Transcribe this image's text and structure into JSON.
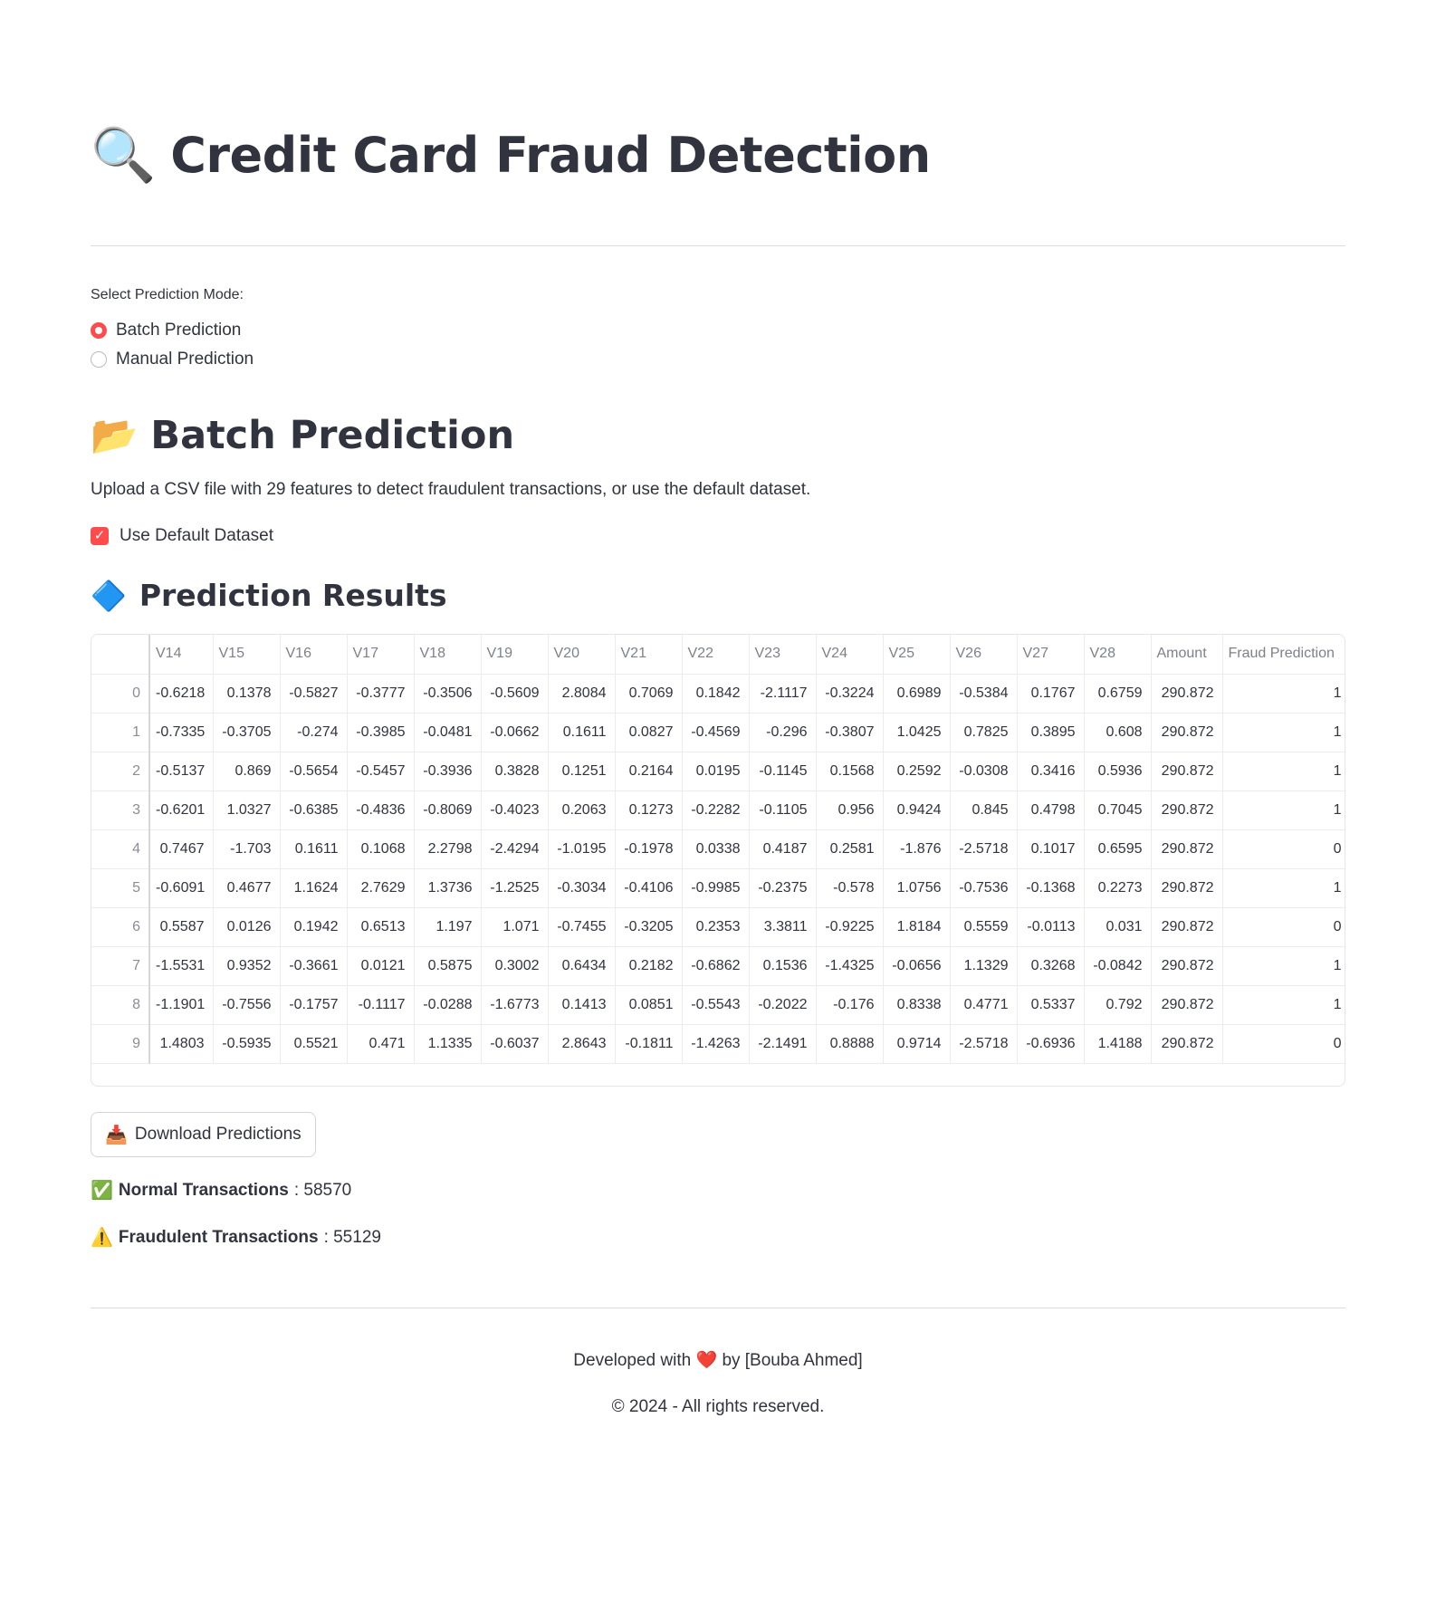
{
  "header": {
    "title_icon": "magnifier-icon",
    "title": "Credit Card Fraud Detection"
  },
  "mode": {
    "label": "Select Prediction Mode:",
    "options": [
      {
        "label": "Batch Prediction",
        "selected": true
      },
      {
        "label": "Manual Prediction",
        "selected": false
      }
    ]
  },
  "batch": {
    "icon": "folder-icon",
    "title": "Batch Prediction",
    "description": "Upload a CSV file with 29 features to detect fraudulent transactions, or use the default dataset.",
    "default_dataset_label": "Use Default Dataset",
    "default_dataset_checked": true
  },
  "results": {
    "icon": "blue-diamond-icon",
    "title": "Prediction Results",
    "columns": [
      "",
      "V14",
      "V15",
      "V16",
      "V17",
      "V18",
      "V19",
      "V20",
      "V21",
      "V22",
      "V23",
      "V24",
      "V25",
      "V26",
      "V27",
      "V28",
      "Amount",
      "Fraud Prediction"
    ],
    "rows": [
      [
        "0",
        "-0.6218",
        "0.1378",
        "-0.5827",
        "-0.3777",
        "-0.3506",
        "-0.5609",
        "2.8084",
        "0.7069",
        "0.1842",
        "-2.1117",
        "-0.3224",
        "0.6989",
        "-0.5384",
        "0.1767",
        "0.6759",
        "290.872",
        "1"
      ],
      [
        "1",
        "-0.7335",
        "-0.3705",
        "-0.274",
        "-0.3985",
        "-0.0481",
        "-0.0662",
        "0.1611",
        "0.0827",
        "-0.4569",
        "-0.296",
        "-0.3807",
        "1.0425",
        "0.7825",
        "0.3895",
        "0.608",
        "290.872",
        "1"
      ],
      [
        "2",
        "-0.5137",
        "0.869",
        "-0.5654",
        "-0.5457",
        "-0.3936",
        "0.3828",
        "0.1251",
        "0.2164",
        "0.0195",
        "-0.1145",
        "0.1568",
        "0.2592",
        "-0.0308",
        "0.3416",
        "0.5936",
        "290.872",
        "1"
      ],
      [
        "3",
        "-0.6201",
        "1.0327",
        "-0.6385",
        "-0.4836",
        "-0.8069",
        "-0.4023",
        "0.2063",
        "0.1273",
        "-0.2282",
        "-0.1105",
        "0.956",
        "0.9424",
        "0.845",
        "0.4798",
        "0.7045",
        "290.872",
        "1"
      ],
      [
        "4",
        "0.7467",
        "-1.703",
        "0.1611",
        "0.1068",
        "2.2798",
        "-2.4294",
        "-1.0195",
        "-0.1978",
        "0.0338",
        "0.4187",
        "0.2581",
        "-1.876",
        "-2.5718",
        "0.1017",
        "0.6595",
        "290.872",
        "0"
      ],
      [
        "5",
        "-0.6091",
        "0.4677",
        "1.1624",
        "2.7629",
        "1.3736",
        "-1.2525",
        "-0.3034",
        "-0.4106",
        "-0.9985",
        "-0.2375",
        "-0.578",
        "1.0756",
        "-0.7536",
        "-0.1368",
        "0.2273",
        "290.872",
        "1"
      ],
      [
        "6",
        "0.5587",
        "0.0126",
        "0.1942",
        "0.6513",
        "1.197",
        "1.071",
        "-0.7455",
        "-0.3205",
        "0.2353",
        "3.3811",
        "-0.9225",
        "1.8184",
        "0.5559",
        "-0.0113",
        "0.031",
        "290.872",
        "0"
      ],
      [
        "7",
        "-1.5531",
        "0.9352",
        "-0.3661",
        "0.0121",
        "0.5875",
        "0.3002",
        "0.6434",
        "0.2182",
        "-0.6862",
        "0.1536",
        "-1.4325",
        "-0.0656",
        "1.1329",
        "0.3268",
        "-0.0842",
        "290.872",
        "1"
      ],
      [
        "8",
        "-1.1901",
        "-0.7556",
        "-0.1757",
        "-0.1117",
        "-0.0288",
        "-1.6773",
        "0.1413",
        "0.0851",
        "-0.5543",
        "-0.2022",
        "-0.176",
        "0.8338",
        "0.4771",
        "0.5337",
        "0.792",
        "290.872",
        "1"
      ],
      [
        "9",
        "1.4803",
        "-0.5935",
        "0.5521",
        "0.471",
        "1.1335",
        "-0.6037",
        "2.8643",
        "-0.1811",
        "-1.4263",
        "-2.1491",
        "0.8888",
        "0.9714",
        "-2.5718",
        "-0.6936",
        "1.4188",
        "290.872",
        "0"
      ]
    ]
  },
  "download": {
    "icon": "inbox-tray-icon",
    "label": "Download Predictions"
  },
  "stats": {
    "normal_label": "Normal Transactions",
    "normal_value": ": 58570",
    "fraud_label": "Fraudulent Transactions",
    "fraud_value": ": 55129"
  },
  "footer": {
    "developed_before": "Developed with",
    "developed_after": "by [Bouba Ahmed]",
    "copyright": "© 2024 - All rights reserved."
  },
  "colors": {
    "accent": "#ff4b4b",
    "text": "#31333f"
  }
}
